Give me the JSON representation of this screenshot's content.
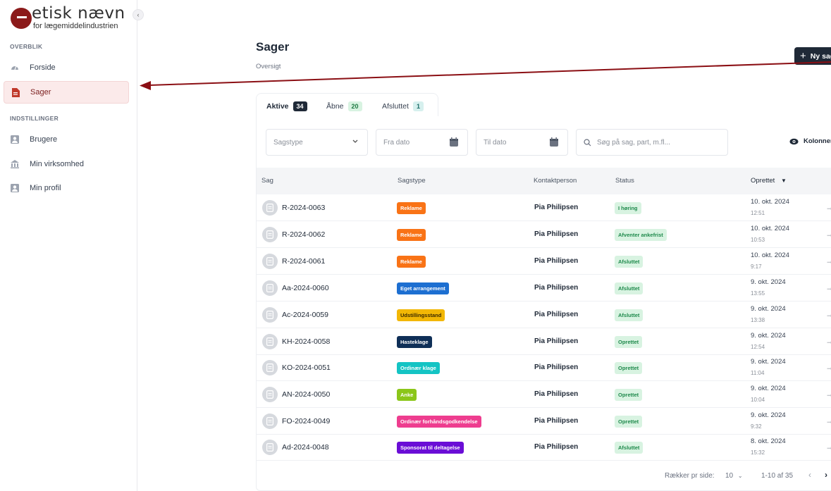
{
  "brand": {
    "title": "etisk nævn",
    "subtitle": "for lægemiddelindustrien"
  },
  "sidebar": {
    "sections": [
      {
        "label": "OVERBLIK",
        "items": [
          {
            "label": "Forside",
            "icon": "dashboard-icon"
          },
          {
            "label": "Sager",
            "icon": "document-icon",
            "active": true
          }
        ]
      },
      {
        "label": "INDSTILLINGER",
        "items": [
          {
            "label": "Brugere",
            "icon": "user-icon"
          },
          {
            "label": "Min virksomhed",
            "icon": "building-icon"
          },
          {
            "label": "Min profil",
            "icon": "user-icon"
          }
        ]
      }
    ]
  },
  "header": {
    "title": "Sager",
    "subtitle": "Oversigt",
    "new_button": "Ny sag"
  },
  "tabs": [
    {
      "label": "Aktive",
      "count": "34"
    },
    {
      "label": "Åbne",
      "count": "20"
    },
    {
      "label": "Afsluttet",
      "count": "1"
    }
  ],
  "filters": {
    "sagstype_placeholder": "Sagstype",
    "fra_dato_placeholder": "Fra dato",
    "til_dato_placeholder": "Til dato",
    "search_placeholder": "Søg på sag, part, m.fl...",
    "columns_label": "Kolonner"
  },
  "table": {
    "columns": [
      "Sag",
      "Sagstype",
      "Kontaktperson",
      "Status",
      "Oprettet"
    ],
    "rows": [
      {
        "sag": "R-2024-0063",
        "type": "Reklame",
        "type_color": "#f97316",
        "contact": "Pia Philipsen",
        "status": "I høring",
        "date": "10. okt. 2024",
        "time": "12:51"
      },
      {
        "sag": "R-2024-0062",
        "type": "Reklame",
        "type_color": "#f97316",
        "contact": "Pia Philipsen",
        "status": "Afventer ankefrist",
        "date": "10. okt. 2024",
        "time": "10:53"
      },
      {
        "sag": "R-2024-0061",
        "type": "Reklame",
        "type_color": "#f97316",
        "contact": "Pia Philipsen",
        "status": "Afsluttet",
        "date": "10. okt. 2024",
        "time": "9:17"
      },
      {
        "sag": "Aa-2024-0060",
        "type": "Eget arrangement",
        "type_color": "#1d6fd1",
        "contact": "Pia Philipsen",
        "status": "Afsluttet",
        "date": "9. okt. 2024",
        "time": "13:55"
      },
      {
        "sag": "Ac-2024-0059",
        "type": "Udstillingsstand",
        "type_color": "#f2b705",
        "contact": "Pia Philipsen",
        "status": "Afsluttet",
        "date": "9. okt. 2024",
        "time": "13:38"
      },
      {
        "sag": "KH-2024-0058",
        "type": "Hasteklage",
        "type_color": "#0f2f57",
        "contact": "Pia Philipsen",
        "status": "Oprettet",
        "date": "9. okt. 2024",
        "time": "12:54"
      },
      {
        "sag": "KO-2024-0051",
        "type": "Ordinær klage",
        "type_color": "#14c4c4",
        "contact": "Pia Philipsen",
        "status": "Oprettet",
        "date": "9. okt. 2024",
        "time": "11:04"
      },
      {
        "sag": "AN-2024-0050",
        "type": "Anke",
        "type_color": "#8bc61a",
        "contact": "Pia Philipsen",
        "status": "Oprettet",
        "date": "9. okt. 2024",
        "time": "10:04"
      },
      {
        "sag": "FO-2024-0049",
        "type": "Ordinær forhåndsgodkendelse",
        "type_color": "#ee3d8f",
        "contact": "Pia Philipsen",
        "status": "Oprettet",
        "date": "9. okt. 2024",
        "time": "9:32"
      },
      {
        "sag": "Ad-2024-0048",
        "type": "Sponsorat til deltagelse",
        "type_color": "#6a0dd6",
        "contact": "Pia Philipsen",
        "status": "Afsluttet",
        "date": "8. okt. 2024",
        "time": "15:32"
      }
    ]
  },
  "pagination": {
    "rows_per_page_label": "Rækker pr side:",
    "rows_per_page_value": "10",
    "range": "1-10 af 35"
  },
  "colors": {
    "accent": "#8b1a1a",
    "dark": "#1f2937",
    "status_green": "#1f8a4c"
  }
}
